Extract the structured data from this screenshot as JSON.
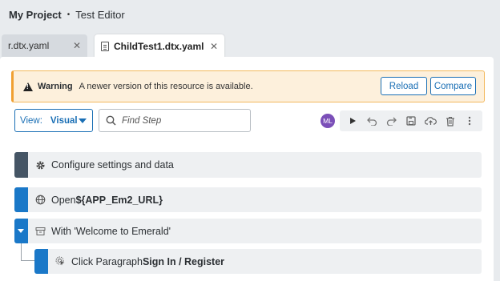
{
  "header": {
    "project": "My Project",
    "separator": "•",
    "page": "Test Editor"
  },
  "tabs": [
    {
      "label": "r.dtx.yaml",
      "close": "✕",
      "active": false
    },
    {
      "label": "ChildTest1.dtx.yaml",
      "close": "✕",
      "active": true
    }
  ],
  "warning": {
    "title": "Warning",
    "message": "A newer version of this resource is available.",
    "reload_label": "Reload",
    "compare_label": "Compare"
  },
  "toolbar": {
    "view_label": "View:",
    "view_value": "Visual",
    "search_placeholder": "Find Step",
    "avatar_initials": "ML",
    "icons": [
      "play-icon",
      "undo-icon",
      "redo-icon",
      "save-icon",
      "upload-cloud-icon",
      "trash-icon",
      "more-vertical-icon"
    ]
  },
  "steps": [
    {
      "icon": "gear-icon",
      "text": "Configure settings and data",
      "bold": ""
    },
    {
      "icon": "globe-icon",
      "text": "Open ",
      "bold": "${APP_Em2_URL}"
    },
    {
      "icon": "archive-icon",
      "text": "With 'Welcome to Emerald'",
      "bold": ""
    },
    {
      "icon": "click-icon",
      "text": "Click Paragraph ",
      "bold": "Sign In / Register"
    }
  ],
  "colors": {
    "accent": "#1a6fb5",
    "warning_bg": "#fdf0dc",
    "warning_border": "#f0a032",
    "avatar": "#7b4fb8"
  }
}
